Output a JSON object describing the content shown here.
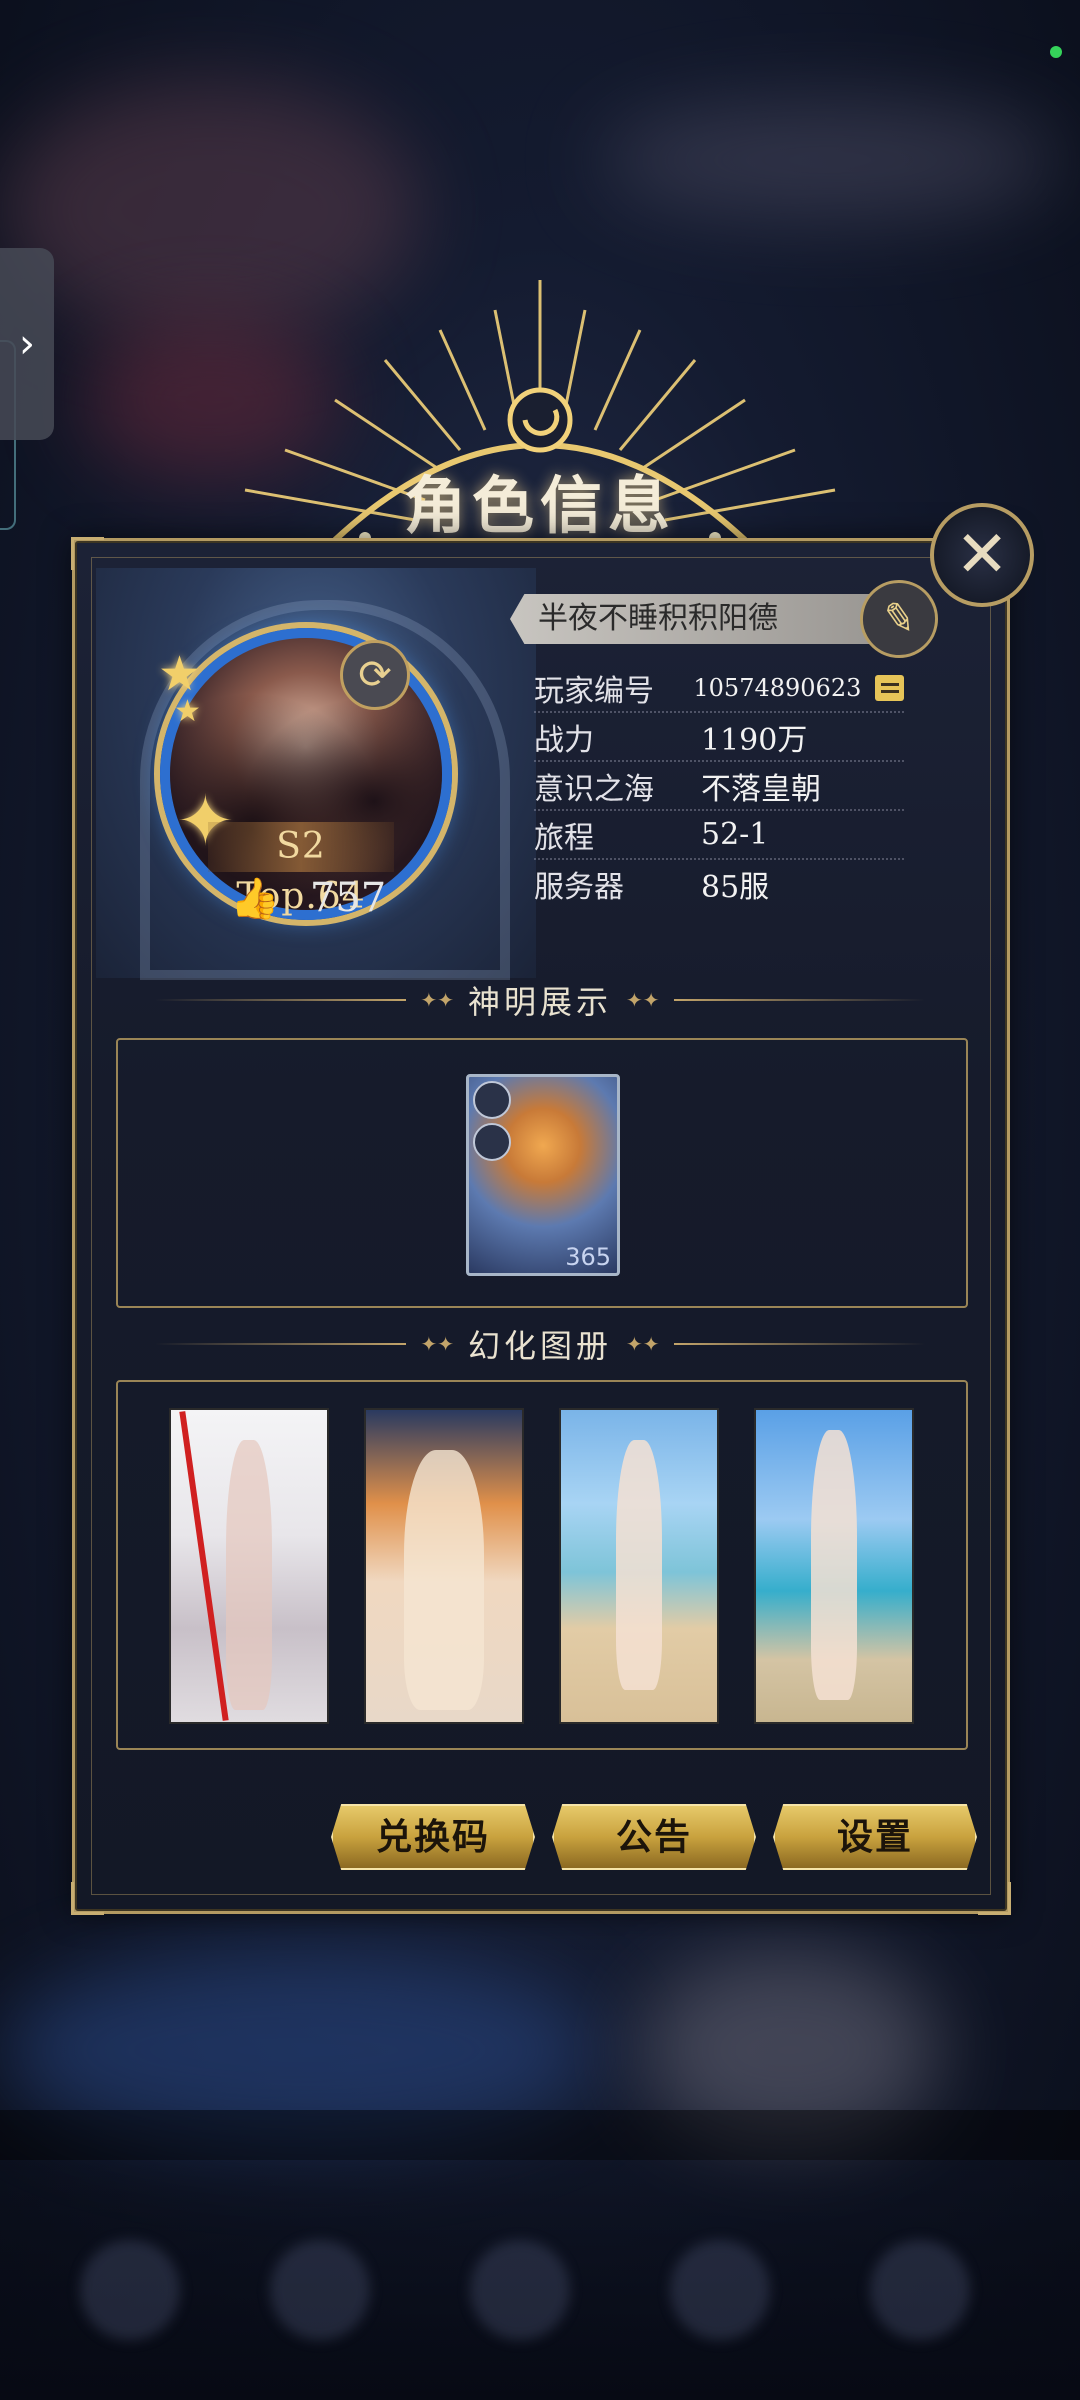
{
  "header": {
    "title": "角色信息"
  },
  "player": {
    "name": "半夜不睡积积阳德",
    "rank_badge": "S2 Top.64",
    "likes": "757",
    "info": [
      {
        "label": "玩家编号",
        "value": "10574890623"
      },
      {
        "label": "战力",
        "value": "1190万"
      },
      {
        "label": "意识之海",
        "value": "不落皇朝"
      },
      {
        "label": "旅程",
        "value": "52-1"
      },
      {
        "label": "服务器",
        "value": "85服"
      }
    ]
  },
  "sections": {
    "deity": {
      "title": "神明展示",
      "card_level": "365"
    },
    "gallery": {
      "title": "幻化图册"
    }
  },
  "buttons": {
    "redeem": "兑换码",
    "notice": "公告",
    "settings": "设置"
  },
  "colors": {
    "gold": "#c2a46a",
    "panel": "#161b2b",
    "status": "#35d35a"
  }
}
